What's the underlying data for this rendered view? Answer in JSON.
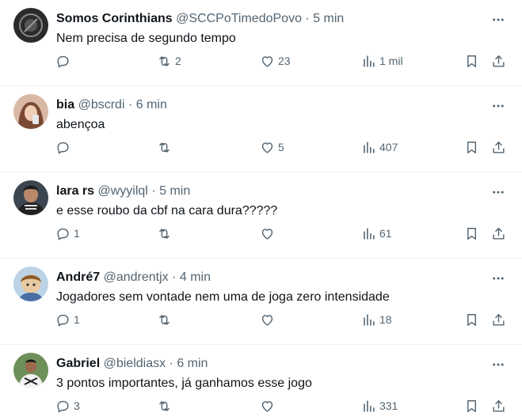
{
  "tweets": [
    {
      "name": "Somos Corinthians",
      "handle": "@SCCPoTimedoPovo",
      "separator": "·",
      "time": "5 min",
      "text": "Nem precisa de segundo tempo",
      "replies": "",
      "retweets": "2",
      "likes": "23",
      "views": "1 mil"
    },
    {
      "name": "bia",
      "handle": "@bscrdi",
      "separator": "·",
      "time": "6 min",
      "text": "abençoa",
      "replies": "",
      "retweets": "",
      "likes": "5",
      "views": "407"
    },
    {
      "name": "lara rs",
      "handle": "@wyyilql",
      "separator": "·",
      "time": "5 min",
      "text": "e esse roubo da cbf na cara dura?????",
      "replies": "1",
      "retweets": "",
      "likes": "",
      "views": "61"
    },
    {
      "name": "André7",
      "handle": "@andrentjx",
      "separator": "·",
      "time": "4 min",
      "text": "Jogadores sem vontade nem uma de joga zero intensidade",
      "replies": "1",
      "retweets": "",
      "likes": "",
      "views": "18"
    },
    {
      "name": "Gabriel",
      "handle": "@bieldiasx",
      "separator": "·",
      "time": "6 min",
      "text": "3 pontos importantes, já ganhamos esse jogo",
      "replies": "3",
      "retweets": "",
      "likes": "",
      "views": "331"
    }
  ],
  "colors": {
    "text": "#0f1419",
    "muted": "#536471",
    "divider": "#eff3f4"
  }
}
